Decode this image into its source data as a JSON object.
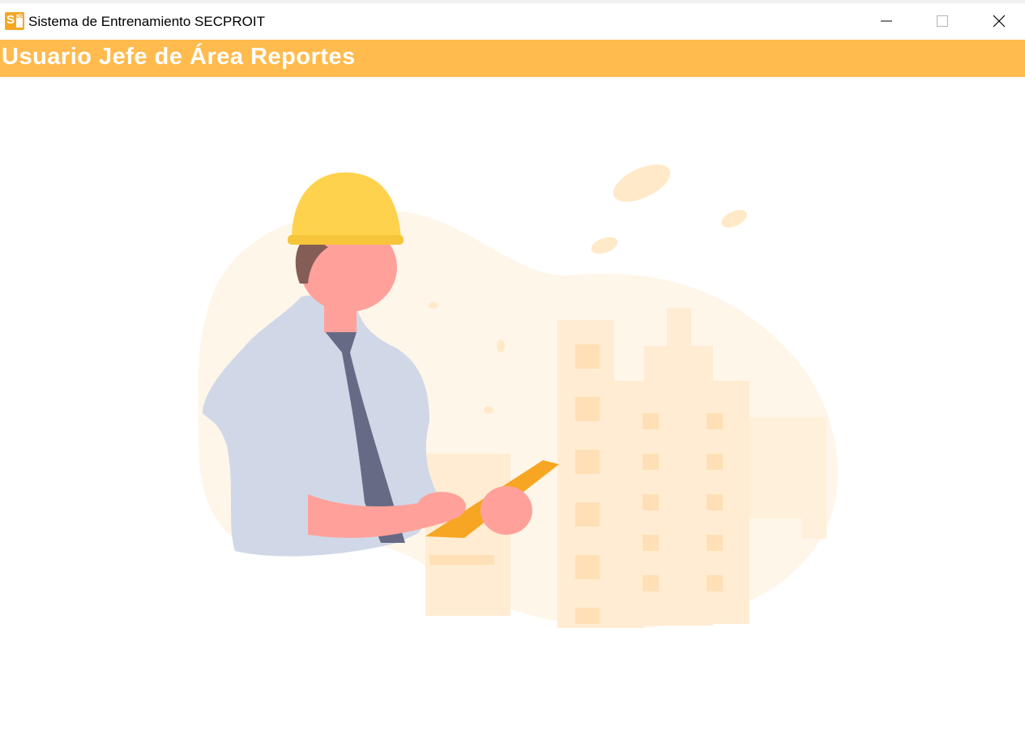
{
  "window": {
    "title": "Sistema de Entrenamiento SECPROIT",
    "icon": "secproit-app-icon",
    "icon_letters": {
      "main": "S",
      "sub": "DE"
    },
    "controls": [
      "minimize-icon",
      "maximize-icon",
      "close-icon"
    ]
  },
  "header": {
    "title": "Usuario Jefe de Área Reportes",
    "background": "#ffbb4d",
    "text_color": "#ffffff"
  },
  "illustration": {
    "subject": "construction-engineer-with-tablet",
    "palette": {
      "helmet": "#ffd24d",
      "skin": "#ffa19a",
      "shirt": "#d0d8e8",
      "tie": "#666a85",
      "tablet": "#f6a623",
      "blob": "#fff6ea",
      "buildings": "#ffecd2"
    }
  }
}
